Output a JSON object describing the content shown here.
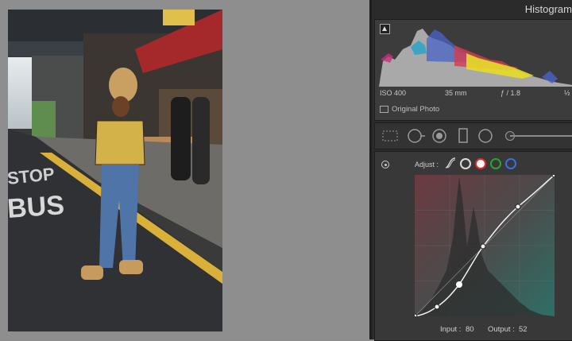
{
  "histogram": {
    "title": "Histogram",
    "iso": "ISO 400",
    "focal_length": "35 mm",
    "aperture": "ƒ / 1.8",
    "exposure_partial": "½",
    "original_photo_label": "Original Photo"
  },
  "tools": {
    "icons": [
      "crop-overlay-icon",
      "spot-removal-icon",
      "red-eye-icon",
      "graduated-filter-icon",
      "radial-filter-icon",
      "adjustment-brush-slider"
    ]
  },
  "tone_curve": {
    "adjust_label": "Adjust :",
    "channels": [
      "parametric",
      "point-white",
      "red",
      "green",
      "blue"
    ],
    "channel_colors": {
      "point": "#dcdcdc",
      "red": "#e12b2b",
      "green": "#2fa12f",
      "blue": "#3a6fe0"
    },
    "input_label": "Input :",
    "input_value": "80",
    "output_label": "Output :",
    "output_value": "52"
  },
  "photo": {
    "signage": "BUS STOP"
  }
}
